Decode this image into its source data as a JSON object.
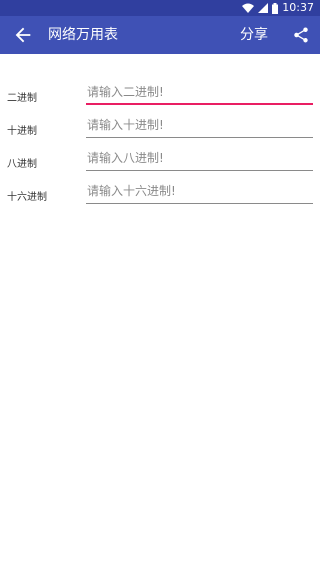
{
  "status_bar": {
    "time": "10:37",
    "icons": [
      "wifi-icon",
      "signal-icon",
      "battery-icon"
    ]
  },
  "app_bar": {
    "title": "网络万用表",
    "share_label": "分享",
    "back_icon": "arrow-back-icon",
    "share_icon": "share-icon"
  },
  "colors": {
    "app_bar": "#3f51b5",
    "status_bar": "#303f9f",
    "focus_underline": "#e91e63"
  },
  "fields": [
    {
      "label": "二进制",
      "placeholder": "请输入二进制!",
      "value": "",
      "focused": true
    },
    {
      "label": "十进制",
      "placeholder": "请输入十进制!",
      "value": ""
    },
    {
      "label": "八进制",
      "placeholder": "请输入八进制!",
      "value": ""
    },
    {
      "label": "十六进制",
      "placeholder": "请输入十六进制!",
      "value": ""
    }
  ]
}
